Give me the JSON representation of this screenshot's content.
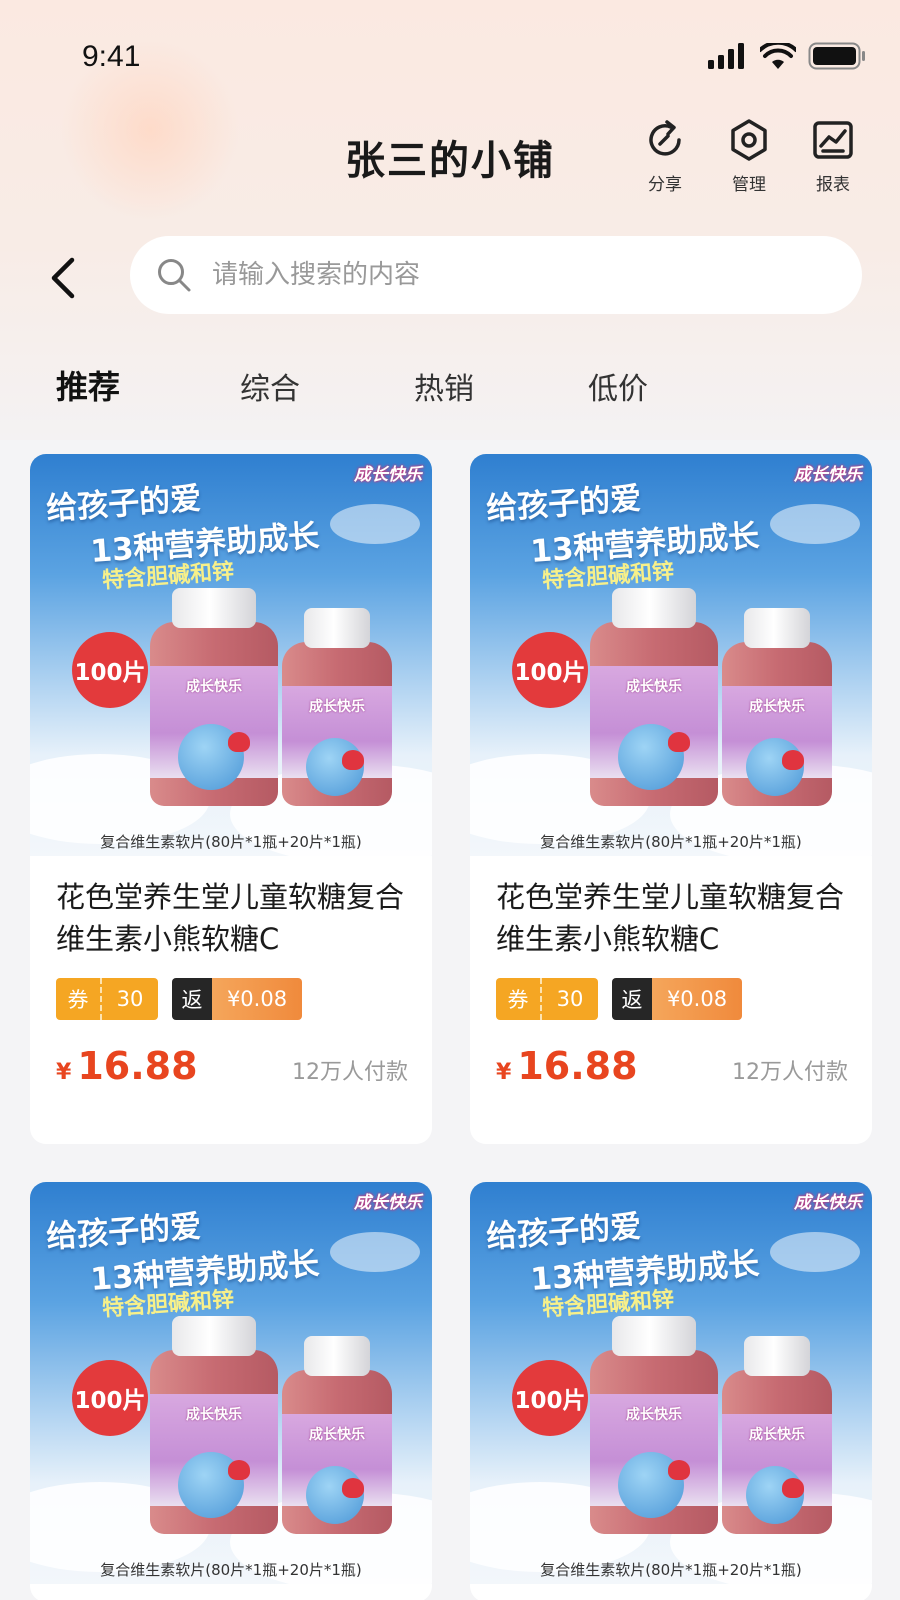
{
  "status_bar": {
    "time": "9:41"
  },
  "header": {
    "title": "张三的小铺",
    "actions": [
      {
        "label": "分享",
        "icon": "share-icon"
      },
      {
        "label": "管理",
        "icon": "manage-icon"
      },
      {
        "label": "报表",
        "icon": "report-icon"
      }
    ]
  },
  "search": {
    "placeholder": "请输入搜索的内容",
    "value": ""
  },
  "tabs": [
    {
      "label": "推荐",
      "active": true
    },
    {
      "label": "综合",
      "active": false
    },
    {
      "label": "热销",
      "active": false
    },
    {
      "label": "低价",
      "active": false
    }
  ],
  "products": [
    {
      "image": {
        "brand": "成长快乐",
        "headline1": "给孩子的爱",
        "headline2": "13种营养助成长",
        "headline3": "特含胆碱和锌",
        "badge": "100片",
        "caption": "复合维生素软片(80片*1瓶+20片*1瓶)"
      },
      "title": "花色堂养生堂儿童软糖复合维生素小熊软糖C",
      "coupon_label": "券",
      "coupon_value": "30",
      "rebate_label": "返",
      "rebate_value": "¥0.08",
      "currency": "¥",
      "price": "16.88",
      "sales": "12万人付款"
    },
    {
      "image": {
        "brand": "成长快乐",
        "headline1": "给孩子的爱",
        "headline2": "13种营养助成长",
        "headline3": "特含胆碱和锌",
        "badge": "100片",
        "caption": "复合维生素软片(80片*1瓶+20片*1瓶)"
      },
      "title": "花色堂养生堂儿童软糖复合维生素小熊软糖C",
      "coupon_label": "券",
      "coupon_value": "30",
      "rebate_label": "返",
      "rebate_value": "¥0.08",
      "currency": "¥",
      "price": "16.88",
      "sales": "12万人付款"
    },
    {
      "image": {
        "brand": "成长快乐",
        "headline1": "给孩子的爱",
        "headline2": "13种营养助成长",
        "headline3": "特含胆碱和锌",
        "badge": "100片",
        "caption": "复合维生素软片(80片*1瓶+20片*1瓶)"
      }
    },
    {
      "image": {
        "brand": "成长快乐",
        "headline1": "给孩子的爱",
        "headline2": "13种营养助成长",
        "headline3": "特含胆碱和锌",
        "badge": "100片",
        "caption": "复合维生素软片(80片*1瓶+20片*1瓶)"
      }
    }
  ],
  "colors": {
    "price": "#e8451f",
    "coupon": "#f5a623",
    "rebate_label_bg": "#262626",
    "rebate_value_bg": "#f08a3c",
    "badge": "#e33a3c"
  }
}
